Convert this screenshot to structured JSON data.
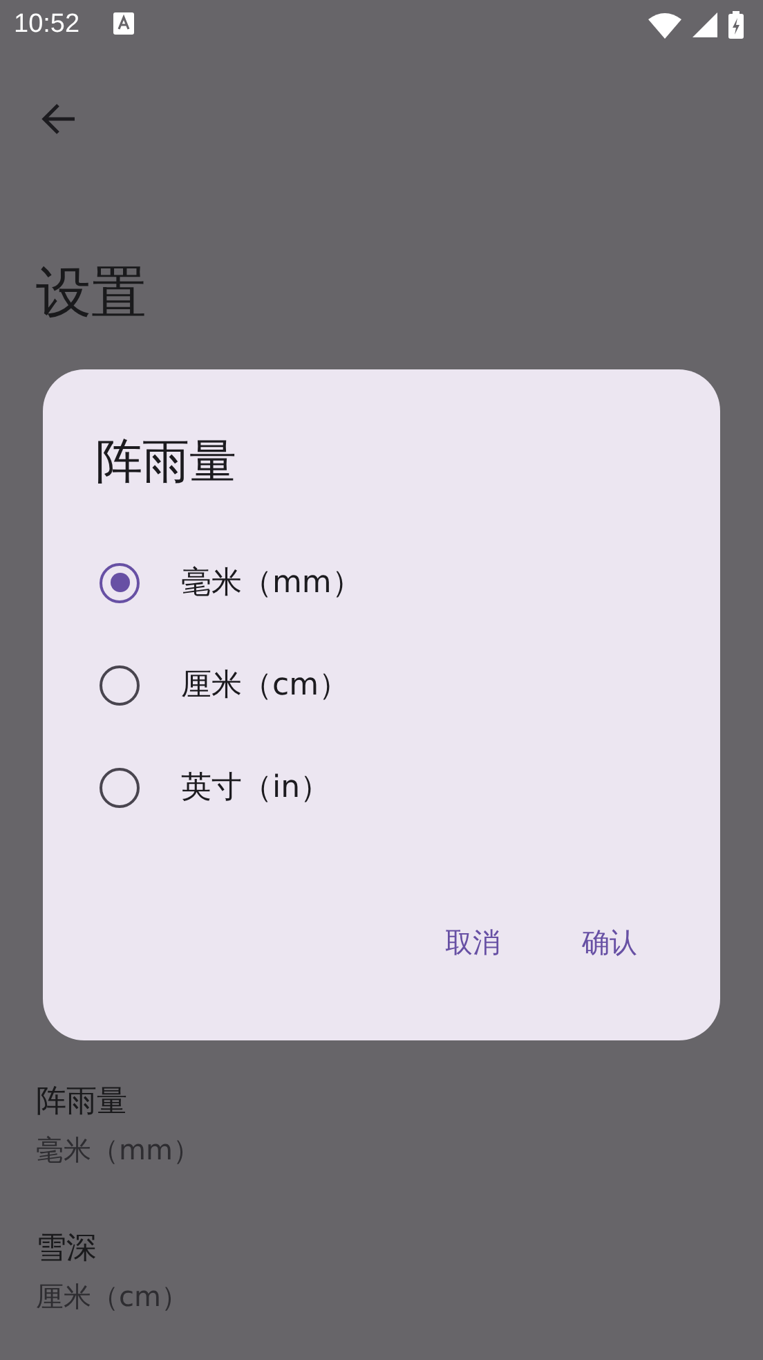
{
  "status_bar": {
    "time": "10:52"
  },
  "page": {
    "title": "设置",
    "items": [
      {
        "title": "阵雨量",
        "value": "毫米（mm）"
      },
      {
        "title": "雪深",
        "value": "厘米（cm）"
      }
    ]
  },
  "dialog": {
    "title": "阵雨量",
    "options": [
      {
        "label": "毫米（mm）",
        "selected": true
      },
      {
        "label": "厘米（cm）",
        "selected": false
      },
      {
        "label": "英寸（in）",
        "selected": false
      }
    ],
    "buttons": [
      "取消",
      "确认"
    ]
  }
}
